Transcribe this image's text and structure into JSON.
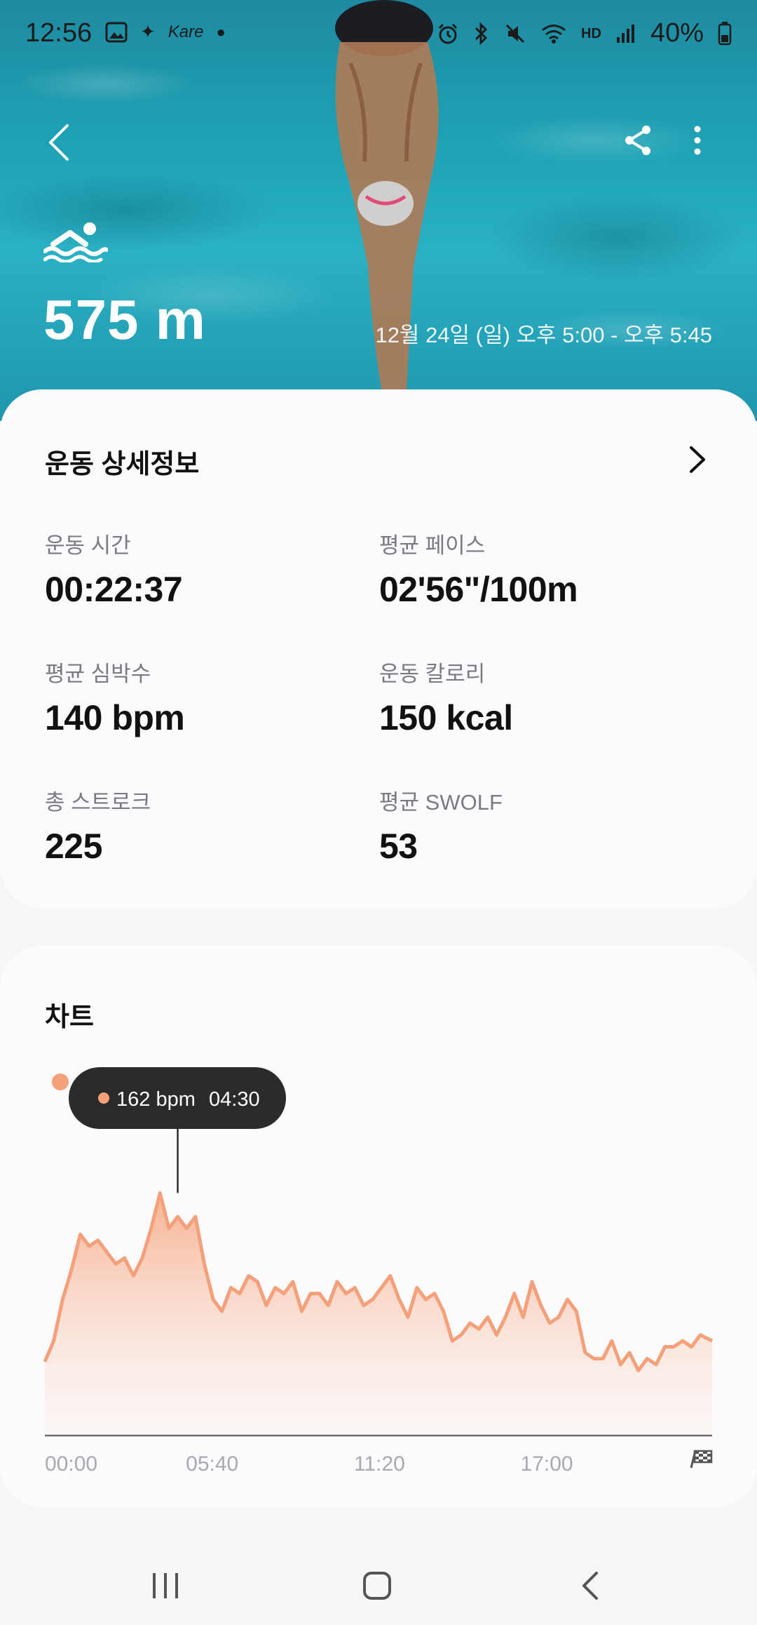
{
  "status_bar": {
    "time": "12:56",
    "left_icons": [
      "gallery-icon",
      "sparkle-icon",
      "kare-app-icon",
      "dot-icon"
    ],
    "kare_label": "Kare",
    "right_icons": [
      "alarm-icon",
      "bluetooth-icon",
      "mute-icon",
      "wifi-icon",
      "hd-voice-icon",
      "signal-icon",
      "battery-icon"
    ],
    "hd_label": "HD",
    "battery": "40%"
  },
  "hero": {
    "distance": "575 m",
    "datetime": "12월 24일 (일) 오후 5:00 - 오후 5:45",
    "activity_icon": "swimming-icon"
  },
  "details": {
    "title": "운동 상세정보",
    "metrics": [
      {
        "label": "운동 시간",
        "value": "00:22:37"
      },
      {
        "label": "평균 페이스",
        "value": "02'56\"/100m"
      },
      {
        "label": "평균 심박수",
        "value": "140 bpm"
      },
      {
        "label": "운동 칼로리",
        "value": "150 kcal"
      },
      {
        "label": "총 스트로크",
        "value": "225"
      },
      {
        "label": "평균 SWOLF",
        "value": "53"
      }
    ]
  },
  "chart": {
    "title": "차트",
    "tooltip": {
      "value": "162 bpm",
      "time": "04:30"
    }
  },
  "chart_data": {
    "type": "area",
    "title": "차트",
    "x_tick_labels": [
      "00:00",
      "05:40",
      "11:20",
      "17:00"
    ],
    "x_range_minutes": [
      0,
      22.6
    ],
    "x_minutes": [
      0,
      0.3,
      0.6,
      0.9,
      1.2,
      1.5,
      1.8,
      2.1,
      2.4,
      2.7,
      3.0,
      3.3,
      3.6,
      3.9,
      4.2,
      4.5,
      4.8,
      5.1,
      5.4,
      5.7,
      6.0,
      6.3,
      6.6,
      6.9,
      7.2,
      7.5,
      7.8,
      8.1,
      8.4,
      8.7,
      9.0,
      9.3,
      9.6,
      9.9,
      10.2,
      10.5,
      10.8,
      11.1,
      11.4,
      11.7,
      12.0,
      12.3,
      12.6,
      12.9,
      13.2,
      13.5,
      13.8,
      14.1,
      14.4,
      14.7,
      15.0,
      15.3,
      15.6,
      15.9,
      16.2,
      16.5,
      16.8,
      17.1,
      17.4,
      17.7,
      18.0,
      18.3,
      18.6,
      18.9,
      19.2,
      19.5,
      19.8,
      20.1,
      20.4,
      20.7,
      21.0,
      21.3,
      21.6,
      21.9,
      22.2,
      22.6
    ],
    "bpm": [
      105,
      112,
      126,
      136,
      148,
      144,
      146,
      142,
      138,
      140,
      134,
      140,
      150,
      162,
      150,
      154,
      150,
      154,
      138,
      126,
      122,
      130,
      128,
      134,
      132,
      124,
      130,
      128,
      132,
      122,
      128,
      128,
      124,
      132,
      128,
      130,
      124,
      126,
      130,
      134,
      126,
      120,
      130,
      126,
      128,
      122,
      112,
      114,
      118,
      116,
      120,
      114,
      120,
      128,
      120,
      132,
      124,
      118,
      120,
      126,
      122,
      108,
      106,
      106,
      112,
      104,
      108,
      102,
      106,
      104,
      110,
      110,
      112,
      110,
      114,
      112
    ],
    "y_range": [
      80,
      200
    ],
    "highlight": {
      "x_minutes": 4.5,
      "bpm": 162,
      "label": "162 bpm",
      "time": "04:30"
    },
    "color": "#f4a07a",
    "finish_icon": "checkered-flag-icon"
  },
  "navbar": {
    "icons": [
      "recents-icon",
      "home-icon",
      "back-nav-icon"
    ]
  },
  "colors": {
    "accent": "#f4a07a",
    "tooltip_bg": "#2b2b2b",
    "card_bg": "#fbfbfd"
  }
}
